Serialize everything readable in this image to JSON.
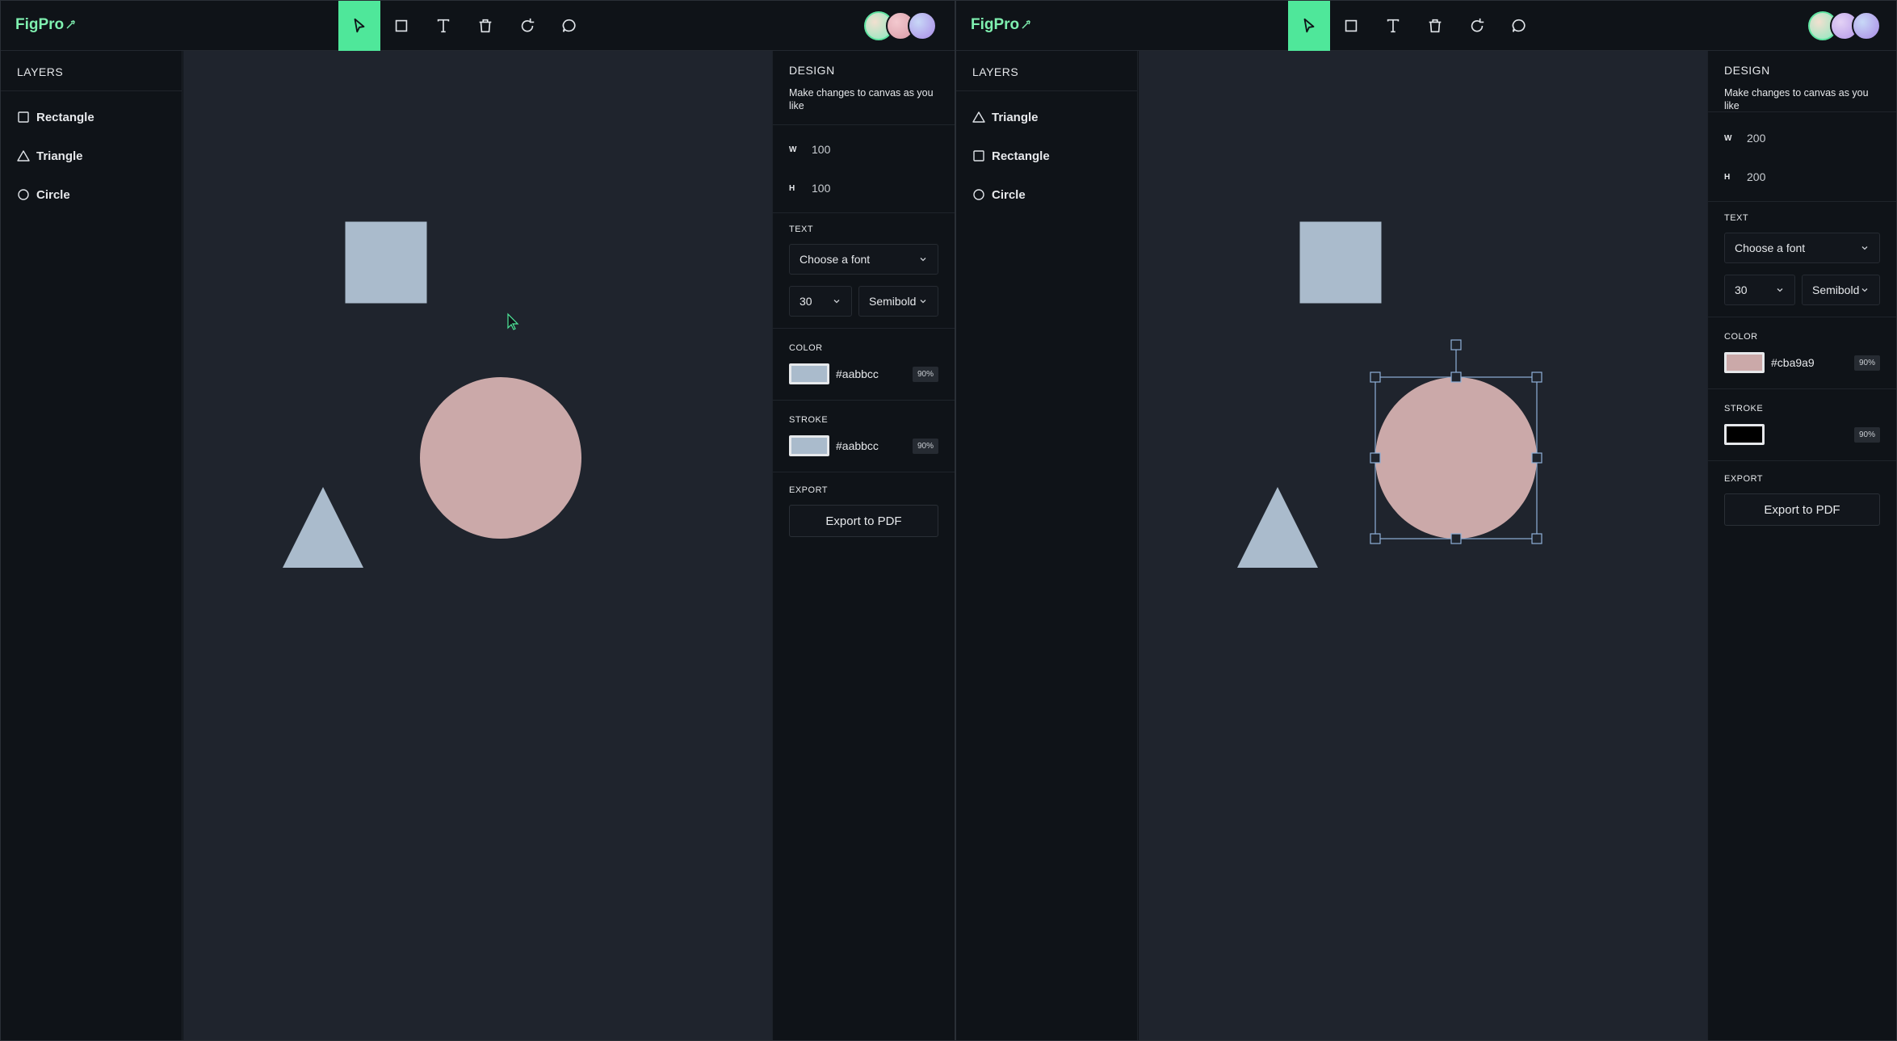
{
  "app": {
    "logo_text": "FigPro"
  },
  "toolbar": {
    "tools": [
      {
        "name": "select",
        "icon": "cursor-icon"
      },
      {
        "name": "rectangle",
        "icon": "square-icon"
      },
      {
        "name": "text",
        "icon": "text-icon"
      },
      {
        "name": "delete",
        "icon": "trash-icon"
      },
      {
        "name": "reset",
        "icon": "rotate-icon"
      },
      {
        "name": "comment",
        "icon": "chat-bubble-icon"
      }
    ],
    "active_tool": "select",
    "accent": "#4fe79a"
  },
  "left": {
    "layers": {
      "title": "LAYERS",
      "items": [
        {
          "label": "Rectangle",
          "icon": "square-icon"
        },
        {
          "label": "Triangle",
          "icon": "triangle-icon"
        },
        {
          "label": "Circle",
          "icon": "circle-icon"
        }
      ]
    },
    "design": {
      "title": "DESIGN",
      "description": "Make changes to canvas as you like",
      "width_key": "W",
      "width_value": "100",
      "height_key": "H",
      "height_value": "100",
      "text_label": "TEXT",
      "font_placeholder": "Choose a font",
      "font_size": "30",
      "font_weight": "Semibold",
      "color_label": "COLOR",
      "color_hex": "#aabbcc",
      "color_opacity": "90%",
      "stroke_label": "STROKE",
      "stroke_hex": "#aabbcc",
      "stroke_opacity": "90%",
      "export_label": "EXPORT",
      "export_button": "Export to PDF"
    }
  },
  "right": {
    "layers": {
      "title": "LAYERS",
      "items": [
        {
          "label": "Triangle",
          "icon": "triangle-icon"
        },
        {
          "label": "Rectangle",
          "icon": "square-icon"
        },
        {
          "label": "Circle",
          "icon": "circle-icon"
        }
      ]
    },
    "design": {
      "title": "DESIGN",
      "description": "Make changes to canvas as you like",
      "width_key": "W",
      "width_value": "200",
      "height_key": "H",
      "height_value": "200",
      "text_label": "TEXT",
      "font_placeholder": "Choose a font",
      "font_size": "30",
      "font_weight": "Semibold",
      "color_label": "COLOR",
      "color_hex": "#cba9a9",
      "color_opacity": "90%",
      "stroke_label": "STROKE",
      "stroke_hex": "",
      "stroke_opacity": "90%",
      "export_label": "EXPORT",
      "export_button": "Export to PDF"
    }
  },
  "colors": {
    "shape_blue": "#aabbcc",
    "shape_pink": "#cba9a9",
    "canvas_bg": "#1f242d",
    "panel_bg": "#0f1318",
    "selection": "#8fb0d8"
  }
}
